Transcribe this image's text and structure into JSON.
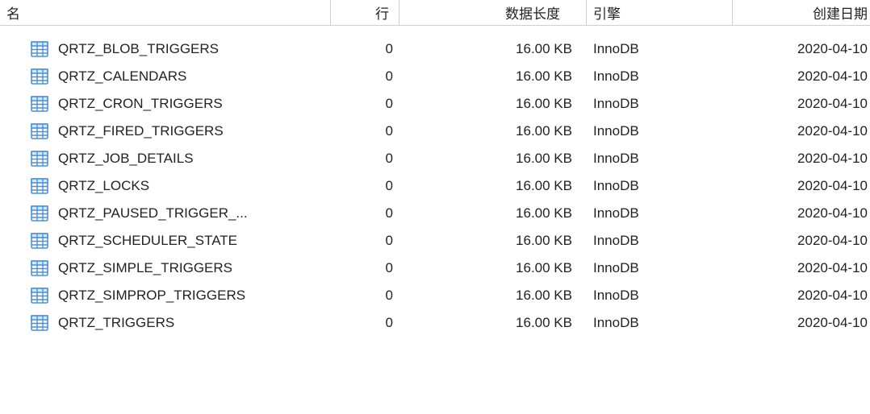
{
  "headers": {
    "name": "名",
    "rows": "行",
    "length": "数据长度",
    "engine": "引擎",
    "date": "创建日期"
  },
  "tables": [
    {
      "name": "QRTZ_BLOB_TRIGGERS",
      "rows": "0",
      "length": "16.00 KB",
      "engine": "InnoDB",
      "date": "2020-04-10"
    },
    {
      "name": "QRTZ_CALENDARS",
      "rows": "0",
      "length": "16.00 KB",
      "engine": "InnoDB",
      "date": "2020-04-10"
    },
    {
      "name": "QRTZ_CRON_TRIGGERS",
      "rows": "0",
      "length": "16.00 KB",
      "engine": "InnoDB",
      "date": "2020-04-10"
    },
    {
      "name": "QRTZ_FIRED_TRIGGERS",
      "rows": "0",
      "length": "16.00 KB",
      "engine": "InnoDB",
      "date": "2020-04-10"
    },
    {
      "name": "QRTZ_JOB_DETAILS",
      "rows": "0",
      "length": "16.00 KB",
      "engine": "InnoDB",
      "date": "2020-04-10"
    },
    {
      "name": "QRTZ_LOCKS",
      "rows": "0",
      "length": "16.00 KB",
      "engine": "InnoDB",
      "date": "2020-04-10"
    },
    {
      "name": "QRTZ_PAUSED_TRIGGER_...",
      "rows": "0",
      "length": "16.00 KB",
      "engine": "InnoDB",
      "date": "2020-04-10"
    },
    {
      "name": "QRTZ_SCHEDULER_STATE",
      "rows": "0",
      "length": "16.00 KB",
      "engine": "InnoDB",
      "date": "2020-04-10"
    },
    {
      "name": "QRTZ_SIMPLE_TRIGGERS",
      "rows": "0",
      "length": "16.00 KB",
      "engine": "InnoDB",
      "date": "2020-04-10"
    },
    {
      "name": "QRTZ_SIMPROP_TRIGGERS",
      "rows": "0",
      "length": "16.00 KB",
      "engine": "InnoDB",
      "date": "2020-04-10"
    },
    {
      "name": "QRTZ_TRIGGERS",
      "rows": "0",
      "length": "16.00 KB",
      "engine": "InnoDB",
      "date": "2020-04-10"
    }
  ]
}
